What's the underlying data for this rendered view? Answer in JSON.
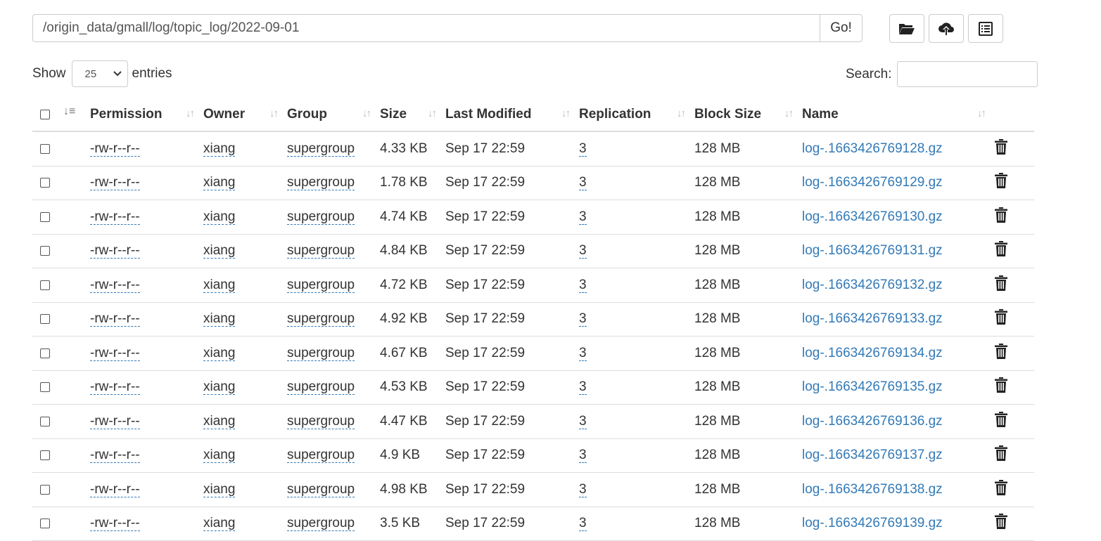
{
  "path": {
    "value": "/origin_data/gmall/log/topic_log/2022-09-01",
    "go_label": "Go!"
  },
  "toolbar": {
    "buttons": [
      "folder-open-icon",
      "cloud-upload-icon",
      "list-alt-icon"
    ]
  },
  "length": {
    "show_label": "Show",
    "value": "25",
    "entries_label": "entries"
  },
  "search": {
    "label": "Search:",
    "value": ""
  },
  "table": {
    "headers": {
      "permission": "Permission",
      "owner": "Owner",
      "group": "Group",
      "size": "Size",
      "modified": "Last Modified",
      "replication": "Replication",
      "block_size": "Block Size",
      "name": "Name"
    },
    "rows": [
      {
        "permission": "-rw-r--r--",
        "owner": "xiang",
        "group": "supergroup",
        "size": "4.33 KB",
        "modified": "Sep 17 22:59",
        "replication": "3",
        "block_size": "128 MB",
        "name": "log-.1663426769128.gz"
      },
      {
        "permission": "-rw-r--r--",
        "owner": "xiang",
        "group": "supergroup",
        "size": "1.78 KB",
        "modified": "Sep 17 22:59",
        "replication": "3",
        "block_size": "128 MB",
        "name": "log-.1663426769129.gz"
      },
      {
        "permission": "-rw-r--r--",
        "owner": "xiang",
        "group": "supergroup",
        "size": "4.74 KB",
        "modified": "Sep 17 22:59",
        "replication": "3",
        "block_size": "128 MB",
        "name": "log-.1663426769130.gz"
      },
      {
        "permission": "-rw-r--r--",
        "owner": "xiang",
        "group": "supergroup",
        "size": "4.84 KB",
        "modified": "Sep 17 22:59",
        "replication": "3",
        "block_size": "128 MB",
        "name": "log-.1663426769131.gz"
      },
      {
        "permission": "-rw-r--r--",
        "owner": "xiang",
        "group": "supergroup",
        "size": "4.72 KB",
        "modified": "Sep 17 22:59",
        "replication": "3",
        "block_size": "128 MB",
        "name": "log-.1663426769132.gz"
      },
      {
        "permission": "-rw-r--r--",
        "owner": "xiang",
        "group": "supergroup",
        "size": "4.92 KB",
        "modified": "Sep 17 22:59",
        "replication": "3",
        "block_size": "128 MB",
        "name": "log-.1663426769133.gz"
      },
      {
        "permission": "-rw-r--r--",
        "owner": "xiang",
        "group": "supergroup",
        "size": "4.67 KB",
        "modified": "Sep 17 22:59",
        "replication": "3",
        "block_size": "128 MB",
        "name": "log-.1663426769134.gz"
      },
      {
        "permission": "-rw-r--r--",
        "owner": "xiang",
        "group": "supergroup",
        "size": "4.53 KB",
        "modified": "Sep 17 22:59",
        "replication": "3",
        "block_size": "128 MB",
        "name": "log-.1663426769135.gz"
      },
      {
        "permission": "-rw-r--r--",
        "owner": "xiang",
        "group": "supergroup",
        "size": "4.47 KB",
        "modified": "Sep 17 22:59",
        "replication": "3",
        "block_size": "128 MB",
        "name": "log-.1663426769136.gz"
      },
      {
        "permission": "-rw-r--r--",
        "owner": "xiang",
        "group": "supergroup",
        "size": "4.9 KB",
        "modified": "Sep 17 22:59",
        "replication": "3",
        "block_size": "128 MB",
        "name": "log-.1663426769137.gz"
      },
      {
        "permission": "-rw-r--r--",
        "owner": "xiang",
        "group": "supergroup",
        "size": "4.98 KB",
        "modified": "Sep 17 22:59",
        "replication": "3",
        "block_size": "128 MB",
        "name": "log-.1663426769138.gz"
      },
      {
        "permission": "-rw-r--r--",
        "owner": "xiang",
        "group": "supergroup",
        "size": "3.5 KB",
        "modified": "Sep 17 22:59",
        "replication": "3",
        "block_size": "128 MB",
        "name": "log-.1663426769139.gz"
      }
    ]
  },
  "colors": {
    "link": "#337ab7",
    "border": "#dddddd"
  }
}
